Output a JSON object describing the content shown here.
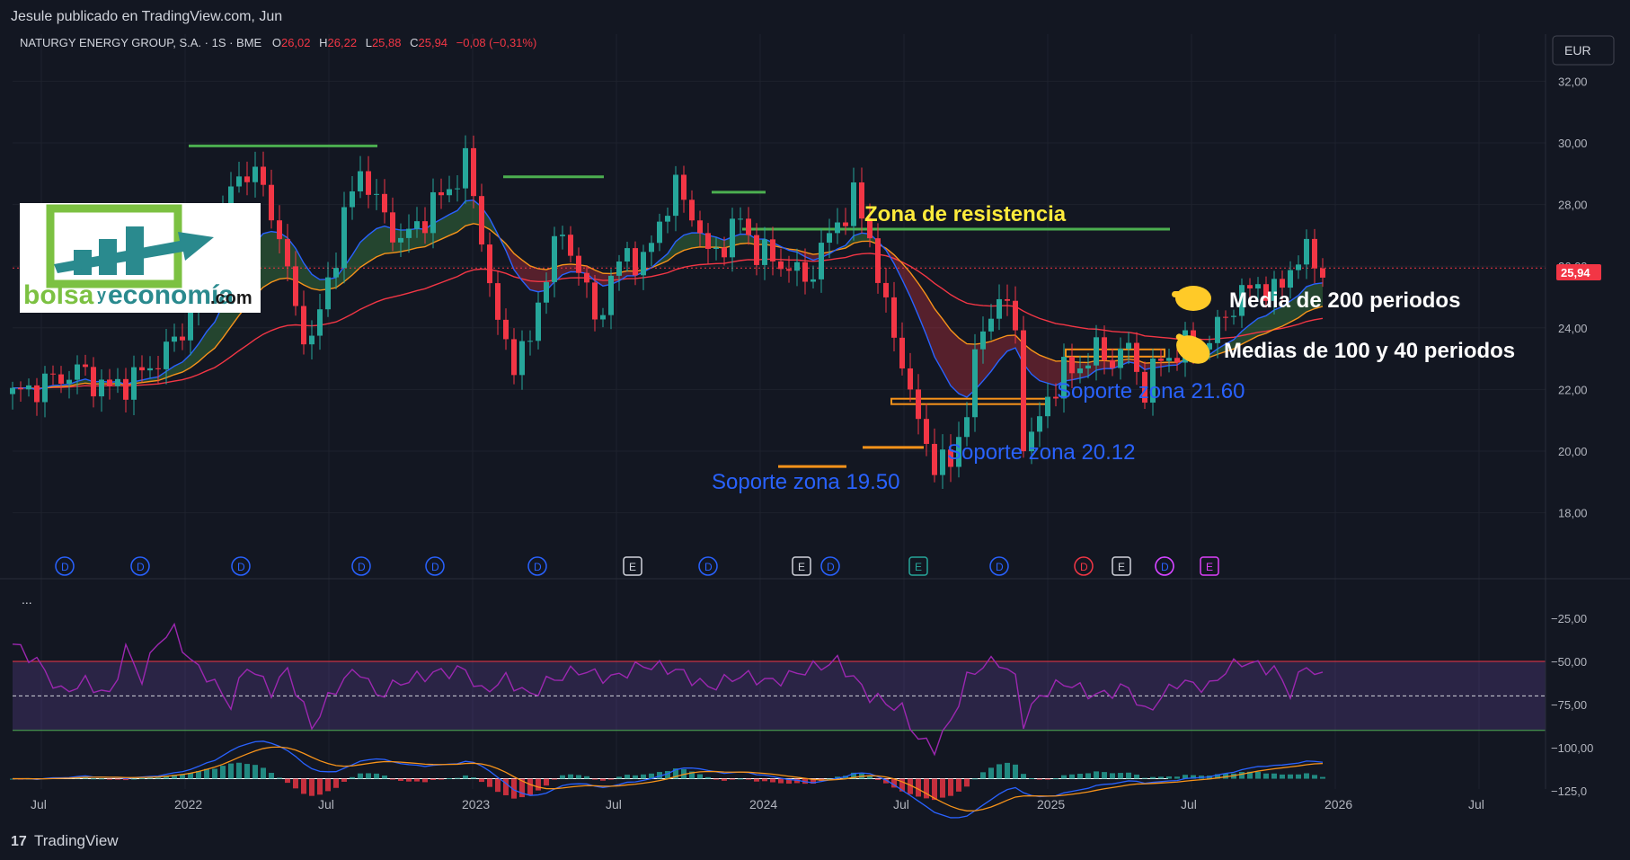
{
  "header": {
    "published_by": "Jesule publicado en TradingView.com, Jun"
  },
  "footer": {
    "brand": "TradingView",
    "logo_icon": "tradingview-logo-icon"
  },
  "symbol": {
    "name": "NATURGY ENERGY GROUP, S.A. · 1S · BME",
    "o_label": "O",
    "o": "26,02",
    "h_label": "H",
    "h": "26,22",
    "l_label": "L",
    "l": "25,88",
    "c_label": "C",
    "c": "25,94",
    "change": "−0,08 (−0,31%)",
    "currency": "EUR",
    "last_price": "25,94"
  },
  "colors": {
    "background": "#131722",
    "up": "#26a69a",
    "down": "#f23645",
    "ema_fast": "#2962ff",
    "ema_mid": "#f7931a",
    "ema_slow": "#f23645",
    "resistance": "#4caf50",
    "support_box": "#f7931a",
    "annotation_blue": "#2962ff",
    "annotation_yellow": "#ffeb3b",
    "rsi": "#9c27b0"
  },
  "logo": {
    "text_a": "bolsa",
    "text_b": "y",
    "text_c": "economía",
    "text_d": ".com",
    "icon": "bar-chart-arrow-icon"
  },
  "annotations": {
    "resistance": "Zona de resistencia",
    "ma200": "Media de 200 periodos",
    "ma100_40": "Medias de 100 y 40 periodos",
    "support_2160": "Soporte zona 21.60",
    "support_2012": "Soporte zona 20.12",
    "support_1950": "Soporte zona 19.50",
    "pointer_icon": "pointing-hand-icon"
  },
  "events": [
    "D",
    "D",
    "D",
    "D",
    "D",
    "D",
    "E",
    "D",
    "E",
    "D",
    "E",
    "D",
    "D",
    "E",
    "D",
    "E"
  ],
  "more_label": "...",
  "chart_data": {
    "type": "candlestick",
    "price_axis": {
      "min": 18,
      "max": 32,
      "ticks": [
        "32,00",
        "30,00",
        "28,00",
        "26,00",
        "24,00",
        "22,00",
        "20,00",
        "18,00"
      ]
    },
    "time_labels": [
      "Jul",
      "2022",
      "Jul",
      "2023",
      "Jul",
      "2024",
      "Jul",
      "2025",
      "Jul",
      "2026",
      "Jul"
    ],
    "oscillator_axis": {
      "ticks": [
        "−25,00",
        "−50,00",
        "−75,00",
        "−100,00",
        "−125,0"
      ]
    },
    "resistance_levels": [
      29.9,
      28.9,
      28.4,
      27.2
    ],
    "support_levels": [
      19.5,
      20.12,
      21.6,
      23.2
    ],
    "price_path": [
      [
        0,
        21.8
      ],
      [
        4,
        22.2
      ],
      [
        8,
        22.6
      ],
      [
        12,
        22.0
      ],
      [
        16,
        22.5
      ],
      [
        20,
        23.5
      ],
      [
        22,
        24.5
      ],
      [
        25,
        26.5
      ],
      [
        27,
        28.5
      ],
      [
        29,
        29.2
      ],
      [
        31,
        28.5
      ],
      [
        33,
        27.0
      ],
      [
        35,
        24.5
      ],
      [
        37,
        23.5
      ],
      [
        39,
        25.5
      ],
      [
        41,
        27.5
      ],
      [
        43,
        29.2
      ],
      [
        45,
        28.0
      ],
      [
        48,
        26.8
      ],
      [
        50,
        27.3
      ],
      [
        52,
        28.0
      ],
      [
        54,
        28.5
      ],
      [
        56,
        29.4
      ],
      [
        58,
        27.0
      ],
      [
        60,
        24.0
      ],
      [
        62,
        23.0
      ],
      [
        64,
        23.5
      ],
      [
        66,
        26.0
      ],
      [
        68,
        27.0
      ],
      [
        70,
        26.0
      ],
      [
        72,
        24.2
      ],
      [
        74,
        25.5
      ],
      [
        76,
        26.5
      ],
      [
        78,
        26.0
      ],
      [
        80,
        27.5
      ],
      [
        82,
        28.5
      ],
      [
        84,
        27.8
      ],
      [
        86,
        26.3
      ],
      [
        88,
        26.8
      ],
      [
        90,
        27.5
      ],
      [
        92,
        26.5
      ],
      [
        94,
        26.2
      ],
      [
        96,
        26.0
      ],
      [
        98,
        25.5
      ],
      [
        100,
        26.5
      ],
      [
        102,
        27.4
      ],
      [
        104,
        28.2
      ],
      [
        106,
        27.0
      ],
      [
        108,
        24.5
      ],
      [
        110,
        23.0
      ],
      [
        112,
        20.8
      ],
      [
        114,
        19.7
      ],
      [
        116,
        19.5
      ],
      [
        118,
        21.5
      ],
      [
        120,
        24.0
      ],
      [
        122,
        25.0
      ],
      [
        124,
        24.0
      ],
      [
        125,
        20.4
      ],
      [
        126,
        20.3
      ],
      [
        128,
        21.8
      ],
      [
        130,
        22.5
      ],
      [
        132,
        22.8
      ],
      [
        134,
        23.2
      ],
      [
        136,
        23.0
      ],
      [
        138,
        23.3
      ],
      [
        140,
        22.0
      ],
      [
        142,
        23.0
      ],
      [
        144,
        23.2
      ],
      [
        146,
        23.5
      ],
      [
        148,
        23.5
      ],
      [
        150,
        24.5
      ],
      [
        152,
        25.0
      ],
      [
        154,
        25.5
      ],
      [
        156,
        25.0
      ],
      [
        158,
        26.0
      ],
      [
        160,
        26.4
      ],
      [
        162,
        25.9
      ]
    ],
    "rsi_path": [
      [
        0,
        -40
      ],
      [
        3,
        -50
      ],
      [
        6,
        -68
      ],
      [
        9,
        -62
      ],
      [
        12,
        -70
      ],
      [
        14,
        -43
      ],
      [
        16,
        -60
      ],
      [
        18,
        -38
      ],
      [
        20,
        -32
      ],
      [
        22,
        -50
      ],
      [
        24,
        -58
      ],
      [
        27,
        -75
      ],
      [
        29,
        -52
      ],
      [
        32,
        -67
      ],
      [
        34,
        -55
      ],
      [
        37,
        -88
      ],
      [
        39,
        -72
      ],
      [
        41,
        -60
      ],
      [
        43,
        -55
      ],
      [
        45,
        -70
      ],
      [
        48,
        -62
      ],
      [
        52,
        -57
      ],
      [
        56,
        -55
      ],
      [
        58,
        -68
      ],
      [
        61,
        -60
      ],
      [
        64,
        -70
      ],
      [
        66,
        -62
      ],
      [
        70,
        -55
      ],
      [
        74,
        -60
      ],
      [
        78,
        -52
      ],
      [
        82,
        -55
      ],
      [
        86,
        -65
      ],
      [
        90,
        -58
      ],
      [
        94,
        -62
      ],
      [
        98,
        -55
      ],
      [
        102,
        -50
      ],
      [
        106,
        -70
      ],
      [
        110,
        -78
      ],
      [
        112,
        -95
      ],
      [
        114,
        -100
      ],
      [
        116,
        -85
      ],
      [
        118,
        -60
      ],
      [
        120,
        -52
      ],
      [
        122,
        -50
      ],
      [
        124,
        -60
      ],
      [
        125,
        -85
      ],
      [
        127,
        -70
      ],
      [
        130,
        -62
      ],
      [
        134,
        -70
      ],
      [
        138,
        -65
      ],
      [
        140,
        -80
      ],
      [
        144,
        -62
      ],
      [
        148,
        -65
      ],
      [
        150,
        -55
      ],
      [
        152,
        -50
      ],
      [
        156,
        -55
      ],
      [
        158,
        -68
      ],
      [
        160,
        -52
      ],
      [
        162,
        -60
      ]
    ]
  }
}
